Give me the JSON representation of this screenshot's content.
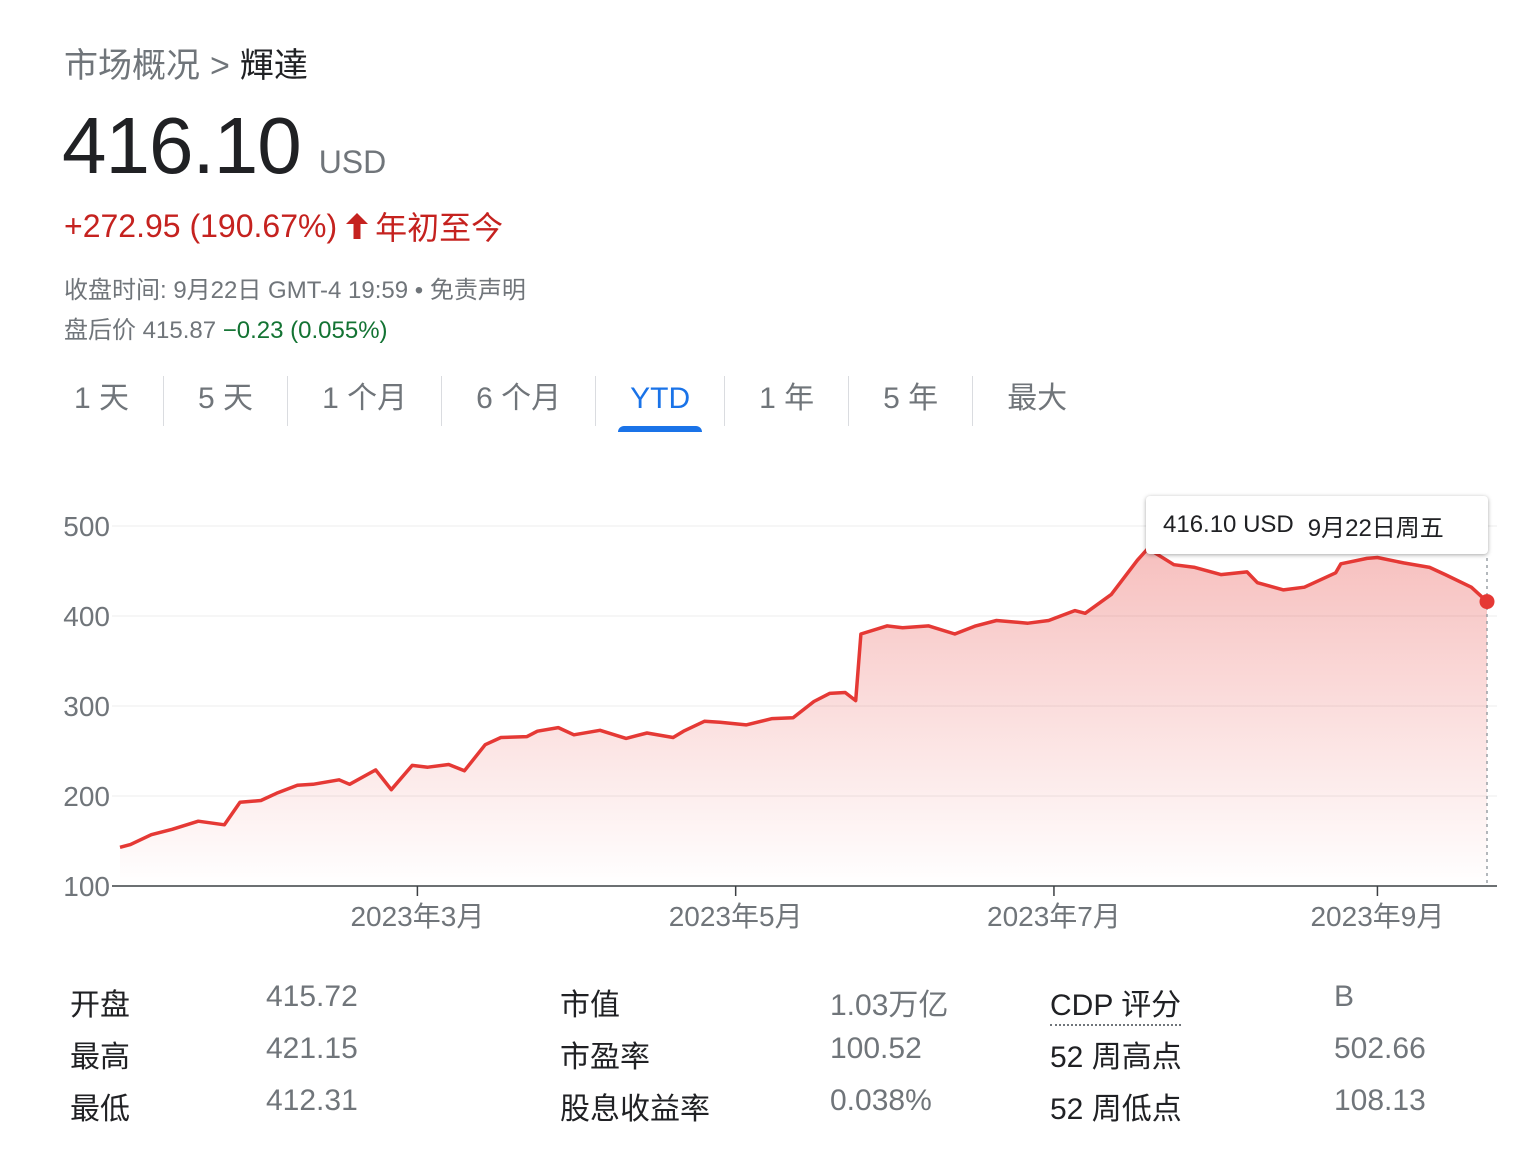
{
  "breadcrumb": {
    "parent": "市场概况",
    "separator": ">",
    "current": "輝達"
  },
  "quote": {
    "price": "416.10",
    "currency": "USD",
    "change": "+272.95 (190.67%)",
    "period": "年初至今",
    "close_time": "收盘时间: 9月22日 GMT-4 19:59",
    "bullet": "•",
    "disclaimer": "免责声明",
    "after_hours_label": "盘后价",
    "after_hours_price": "415.87",
    "after_hours_change": "−0.23 (0.055%)"
  },
  "tabs": [
    {
      "label": "1 天",
      "active": false
    },
    {
      "label": "5 天",
      "active": false
    },
    {
      "label": "1 个月",
      "active": false
    },
    {
      "label": "6 个月",
      "active": false
    },
    {
      "label": "YTD",
      "active": true
    },
    {
      "label": "1 年",
      "active": false
    },
    {
      "label": "5 年",
      "active": false
    },
    {
      "label": "最大",
      "active": false
    }
  ],
  "colors": {
    "line": "#e53935",
    "accent_blue": "#1a73e8",
    "negative_red": "#c5221f",
    "positive_green": "#137333"
  },
  "tooltip": {
    "price": "416.10 USD",
    "date": "9月22日周五"
  },
  "chart_data": {
    "type": "area",
    "x_start": "2023-01-03",
    "x_end": "2023-09-22",
    "ylim": [
      100,
      500
    ],
    "yticks": [
      100,
      200,
      300,
      400,
      500
    ],
    "ytick_labels": [
      "100",
      "200",
      "300",
      "400",
      "500"
    ],
    "xtick_labels": [
      {
        "date": "2023-03-01",
        "label": "2023年3月"
      },
      {
        "date": "2023-05-01",
        "label": "2023年5月"
      },
      {
        "date": "2023-07-01",
        "label": "2023年7月"
      },
      {
        "date": "2023-09-01",
        "label": "2023年9月"
      }
    ],
    "grid": true,
    "series": [
      {
        "x": [
          "2023-01-03",
          "2023-01-05",
          "2023-01-09",
          "2023-01-13",
          "2023-01-18",
          "2023-01-23",
          "2023-01-26",
          "2023-01-30",
          "2023-02-02",
          "2023-02-06",
          "2023-02-09",
          "2023-02-14",
          "2023-02-16",
          "2023-02-21",
          "2023-02-24",
          "2023-02-28",
          "2023-03-03",
          "2023-03-07",
          "2023-03-10",
          "2023-03-14",
          "2023-03-17",
          "2023-03-22",
          "2023-03-24",
          "2023-03-28",
          "2023-03-31",
          "2023-04-05",
          "2023-04-10",
          "2023-04-14",
          "2023-04-19",
          "2023-04-21",
          "2023-04-25",
          "2023-04-28",
          "2023-05-03",
          "2023-05-08",
          "2023-05-12",
          "2023-05-16",
          "2023-05-19",
          "2023-05-22",
          "2023-05-24",
          "2023-05-25",
          "2023-05-30",
          "2023-06-02",
          "2023-06-07",
          "2023-06-12",
          "2023-06-16",
          "2023-06-20",
          "2023-06-26",
          "2023-06-30",
          "2023-07-05",
          "2023-07-07",
          "2023-07-12",
          "2023-07-17",
          "2023-07-19",
          "2023-07-24",
          "2023-07-28",
          "2023-08-02",
          "2023-08-07",
          "2023-08-09",
          "2023-08-14",
          "2023-08-18",
          "2023-08-24",
          "2023-08-25",
          "2023-08-30",
          "2023-09-01",
          "2023-09-06",
          "2023-09-11",
          "2023-09-14",
          "2023-09-19",
          "2023-09-22"
        ],
        "y": [
          143,
          146,
          157,
          163,
          172,
          168,
          193,
          195,
          203,
          212,
          213,
          218,
          213,
          229,
          207,
          234,
          232,
          235,
          228,
          257,
          265,
          266,
          272,
          276,
          268,
          273,
          264,
          270,
          265,
          272,
          283,
          282,
          279,
          286,
          287,
          305,
          314,
          315,
          306,
          380,
          389,
          387,
          389,
          380,
          389,
          395,
          392,
          395,
          406,
          403,
          424,
          462,
          475,
          457,
          454,
          446,
          449,
          437,
          429,
          432,
          448,
          458,
          464,
          465,
          459,
          454,
          446,
          432,
          416
        ]
      }
    ]
  },
  "stats": [
    [
      {
        "label": "开盘",
        "value": "415.72"
      },
      {
        "label": "市值",
        "value": "1.03万亿"
      },
      {
        "label": "CDP 评分",
        "value": "B"
      }
    ],
    [
      {
        "label": "最高",
        "value": "421.15"
      },
      {
        "label": "市盈率",
        "value": "100.52"
      },
      {
        "label": "52 周高点",
        "value": "502.66"
      }
    ],
    [
      {
        "label": "最低",
        "value": "412.31"
      },
      {
        "label": "股息收益率",
        "value": "0.038%"
      },
      {
        "label": "52 周低点",
        "value": "108.13"
      }
    ]
  ]
}
